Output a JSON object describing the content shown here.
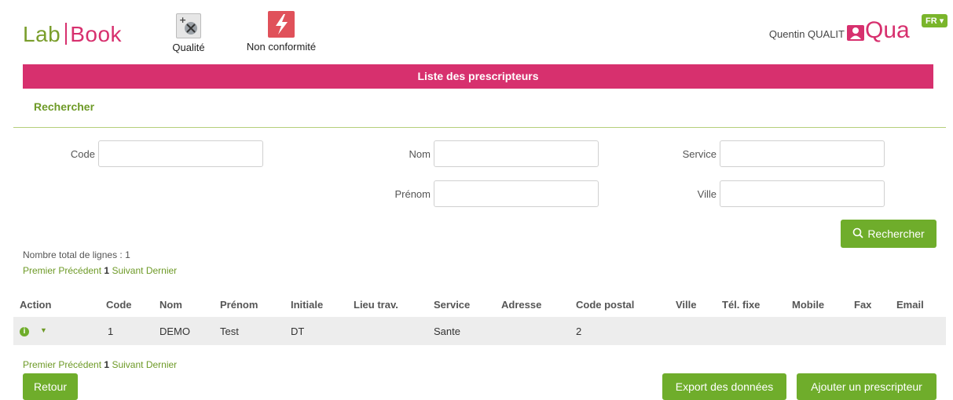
{
  "header": {
    "logo_lab": "Lab",
    "logo_book": "Book",
    "menu": [
      {
        "label": "Qualité",
        "icon": "quality-icon"
      },
      {
        "label": "Non conformité",
        "icon": "nonconformity-icon"
      }
    ],
    "user_name": "Quentin QUALIT",
    "user_short": "Qua",
    "language": "FR"
  },
  "banner_title": "Liste des prescripteurs",
  "search": {
    "title": "Rechercher",
    "fields": {
      "code": {
        "label": "Code",
        "value": ""
      },
      "nom": {
        "label": "Nom",
        "value": ""
      },
      "service": {
        "label": "Service",
        "value": ""
      },
      "prenom": {
        "label": "Prénom",
        "value": ""
      },
      "ville": {
        "label": "Ville",
        "value": ""
      }
    },
    "button": "Rechercher"
  },
  "total_lines": "Nombre total de lignes : 1",
  "pager": {
    "first": "Premier",
    "prev": "Précédent",
    "current": "1",
    "next": "Suivant",
    "last": "Dernier"
  },
  "table": {
    "headers": [
      "Action",
      "Code",
      "Nom",
      "Prénom",
      "Initiale",
      "Lieu trav.",
      "Service",
      "Adresse",
      "Code postal",
      "Ville",
      "Tél. fixe",
      "Mobile",
      "Fax",
      "Email"
    ],
    "rows": [
      {
        "code": "1",
        "nom": "DEMO",
        "prenom": "Test",
        "initiale": "DT",
        "lieu": "",
        "service": "Sante",
        "adresse": "",
        "code_postal": "2",
        "ville": "",
        "tel": "",
        "mobile": "",
        "fax": "",
        "email": ""
      }
    ]
  },
  "footer_buttons": {
    "back": "Retour",
    "export": "Export des données",
    "add": "Ajouter un prescripteur"
  },
  "colors": {
    "brand_pink": "#d7306e",
    "brand_green": "#6fad2b"
  }
}
